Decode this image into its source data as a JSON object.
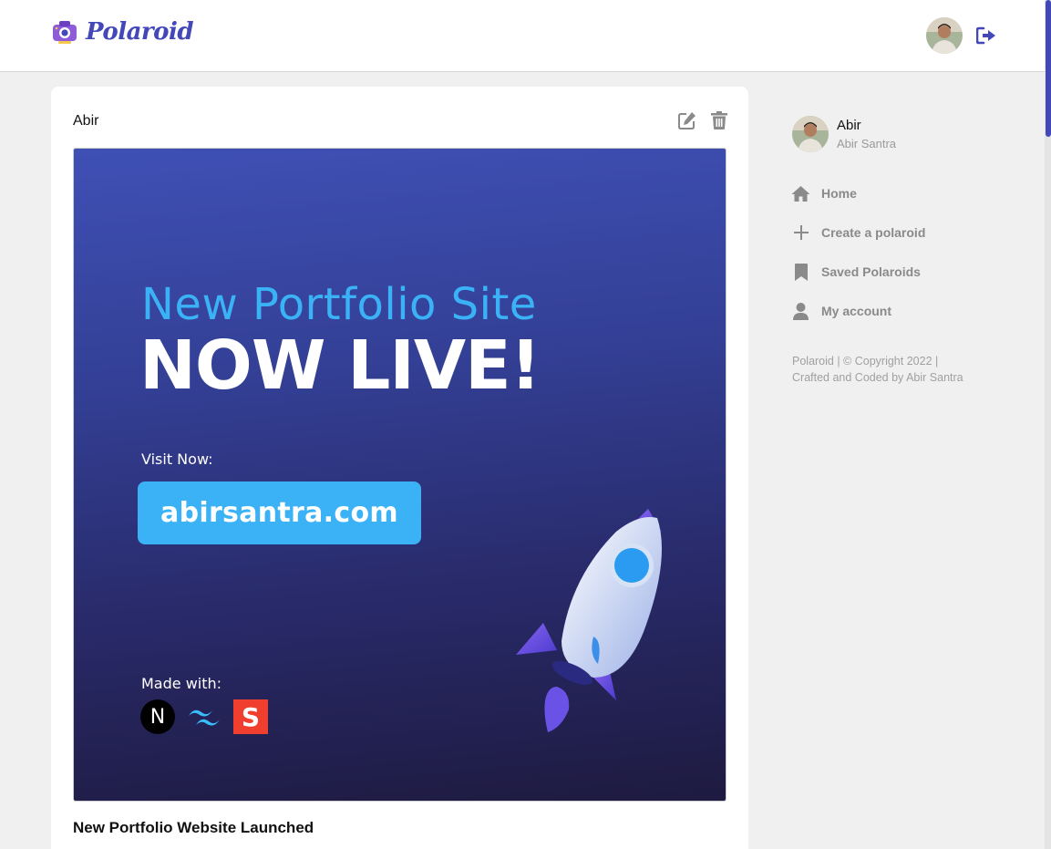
{
  "app": {
    "name": "Polaroid",
    "brand_color": "#4347b8"
  },
  "header": {
    "avatar_icon": "user-avatar",
    "logout_icon": "logout-icon"
  },
  "post": {
    "author": "Abir",
    "image": {
      "subtitle": "New Portfolio Site",
      "headline": "NOW LIVE!",
      "visit_label": "Visit Now:",
      "url": "abirsantra.com",
      "made_with_label": "Made with:",
      "tech_icons": [
        "nextjs-icon",
        "tailwind-icon",
        "svelte-icon"
      ],
      "next_letter": "N",
      "svelte_letter": "S"
    },
    "title": "New Portfolio Website Launched"
  },
  "sidebar": {
    "user": {
      "name": "Abir",
      "full_name": "Abir Santra"
    },
    "nav": [
      {
        "label": "Home",
        "icon": "home-icon"
      },
      {
        "label": "Create a polaroid",
        "icon": "plus-icon"
      },
      {
        "label": "Saved Polaroids",
        "icon": "bookmark-icon"
      },
      {
        "label": "My account",
        "icon": "user-icon"
      }
    ],
    "footer": "Polaroid | © Copyright 2022 | Crafted and Coded by Abir Santra"
  }
}
